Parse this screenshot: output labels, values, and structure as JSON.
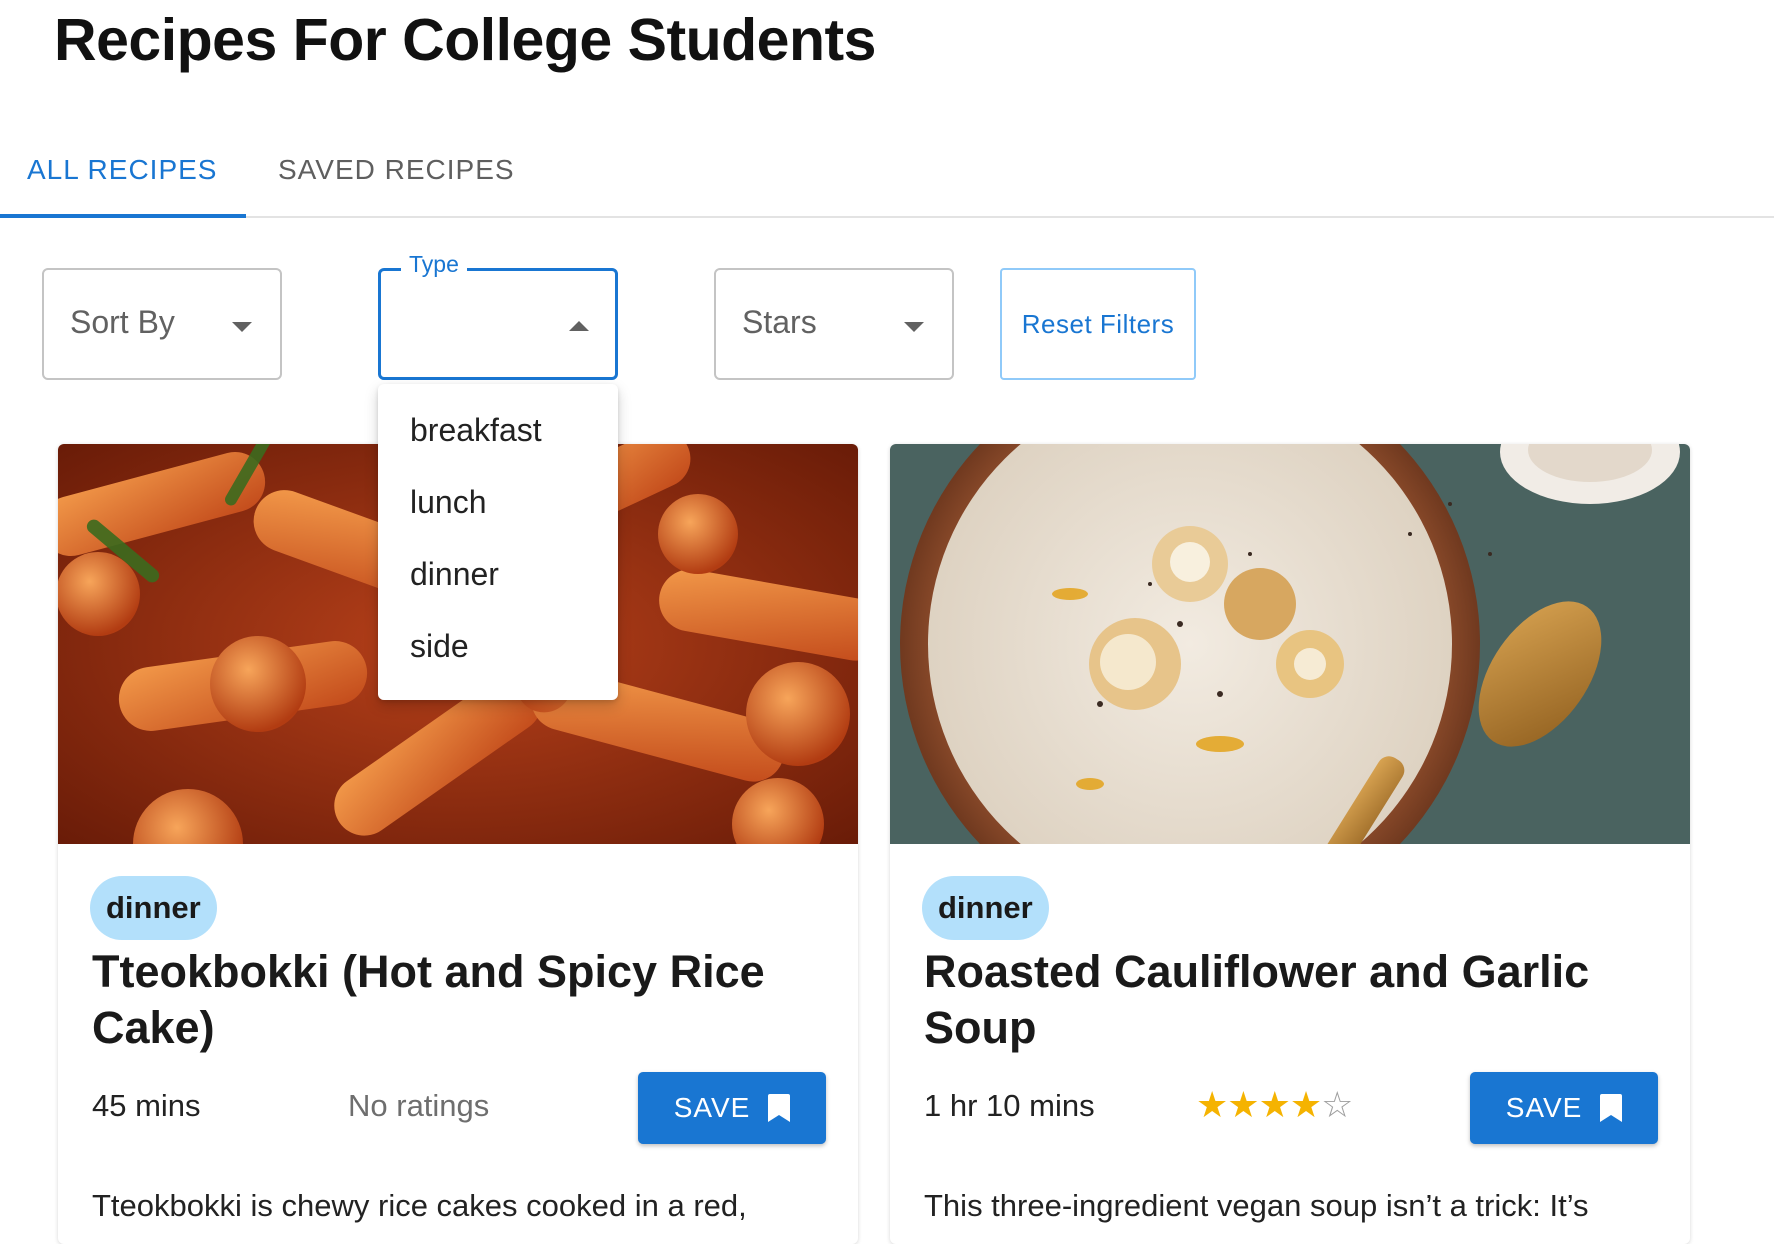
{
  "page": {
    "title": "Recipes For College Students"
  },
  "tabs": [
    {
      "label": "ALL RECIPES",
      "active": true
    },
    {
      "label": "SAVED RECIPES",
      "active": false
    }
  ],
  "filters": {
    "sort_by": {
      "label": "Sort By"
    },
    "type": {
      "label": "Type",
      "value": "",
      "open": true
    },
    "stars": {
      "label": "Stars"
    },
    "reset_label": "Reset Filters"
  },
  "type_menu": {
    "options": [
      "breakfast",
      "lunch",
      "dinner",
      "side"
    ]
  },
  "recipes": [
    {
      "type": "dinner",
      "title": "Tteokbokki (Hot and Spicy Rice Cake)",
      "duration": "45 mins",
      "rating_text": "No ratings",
      "save_label": "SAVE",
      "description": "Tteokbokki is chewy rice cakes cooked in a red,"
    },
    {
      "type": "dinner",
      "title": "Roasted Cauliflower and Garlic Soup",
      "duration": "1 hr 10 mins",
      "rating": 4,
      "rating_max": 5,
      "save_label": "SAVE",
      "description": "This three-ingredient vegan soup isn’t a trick: It’s"
    }
  ],
  "colors": {
    "accent": "#1976d2",
    "chip": "#b3e0fb",
    "star": "#f5b301"
  }
}
